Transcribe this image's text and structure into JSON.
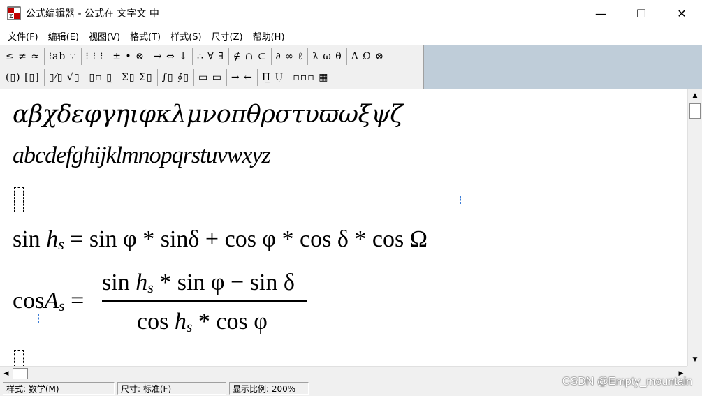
{
  "window": {
    "title": "公式编辑器 - 公式在 文字文 中",
    "minimize": "—",
    "maximize": "☐",
    "close": "✕"
  },
  "menu": [
    {
      "label": "文件(F)"
    },
    {
      "label": "编辑(E)"
    },
    {
      "label": "视图(V)"
    },
    {
      "label": "格式(T)"
    },
    {
      "label": "样式(S)"
    },
    {
      "label": "尺寸(Z)"
    },
    {
      "label": "帮助(H)"
    }
  ],
  "toolbar": {
    "row1": [
      "≤ ≠ ≈",
      "⁞ab ∵",
      "⁞ ⁞ ⁞",
      "± • ⊗",
      "→ ⇔ ↓",
      "∴ ∀ ∃",
      "∉ ∩ ⊂",
      "∂ ∞ ℓ",
      "λ ω θ",
      "Λ Ω ⊗"
    ],
    "row2": [
      "(▯) [▯]",
      "▯⁄▯ √▯",
      "▯▫ ▯̲",
      "Σ▯ Σ▯",
      "∫▯ ∮▯",
      "▭ ▭",
      "→ ←",
      "Π̲ Ụ",
      "▫▫▫ ▦"
    ]
  },
  "editor": {
    "greek_line": "αβχδεφγηιφκλμνοπθρστυϖωξψζ",
    "latin_line": "abcdefghijklmnopqrstuvwxyz",
    "eq1": {
      "sin": "sin",
      "h": "h",
      "s": "s",
      "rest": "= sin φ * sinδ + cos φ * cos δ * cos Ω"
    },
    "eq2": {
      "cos": "cos",
      "A": "A",
      "s": "s",
      "eq": "=",
      "num_sin": "sin",
      "num_h": "h",
      "num_s": "s",
      "num_rest": "* sin φ − sin δ",
      "den_cos": "cos",
      "den_h": "h",
      "den_s": "s",
      "den_rest": "* cos φ"
    }
  },
  "status": {
    "style": "样式: 数学(M)",
    "size": "尺寸: 标准(F)",
    "zoom": "显示比例: 200%"
  },
  "watermark": "CSDN @Empty_mountain"
}
